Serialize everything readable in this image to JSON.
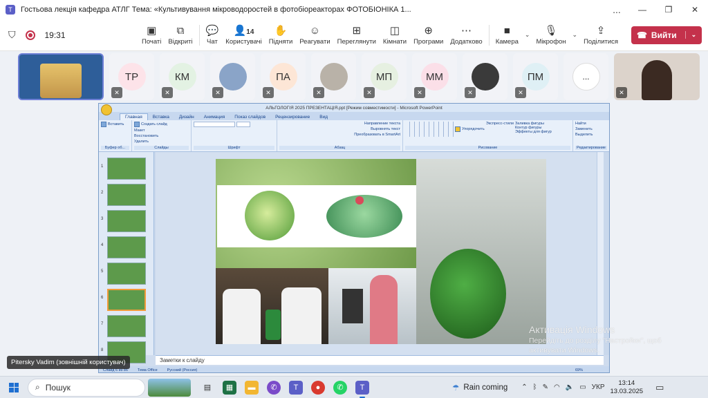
{
  "window": {
    "title": "Гостьова лекція кафедра АТЛГ Тема: «Культивування мікроводоростей в фотобіореакторах ФОТОБІОНІКА 1...",
    "more": "...",
    "minimize": "—",
    "restore": "❐",
    "close": "✕"
  },
  "meeting": {
    "timer": "19:31",
    "participants_count": "14",
    "buttons": {
      "chat": "Чат",
      "people": "Користувачі",
      "raise": "Підняти",
      "react": "Реагувати",
      "view": "Переглянути",
      "rooms": "Кімнати",
      "apps": "Програми",
      "more": "Додатково",
      "camera": "Камера",
      "mic": "Мікрофон",
      "share": "Поділитися",
      "leave": "Вийти"
    },
    "left_tabs": {
      "notes": "Початі",
      "shared": "Відкриті"
    }
  },
  "participants": [
    {
      "initials": "ТР",
      "color": "#fde3e9"
    },
    {
      "initials": "КМ",
      "color": "#e3f2e3"
    },
    {
      "initials": "",
      "color": "#8aa4c8"
    },
    {
      "initials": "ПА",
      "color": "#fde6d6"
    },
    {
      "initials": "",
      "color": "#b9b2a8"
    },
    {
      "initials": "МП",
      "color": "#e6f0e1"
    },
    {
      "initials": "ММ",
      "color": "#fbdfe8"
    },
    {
      "initials": "",
      "color": "#3a3a3a"
    },
    {
      "initials": "ПМ",
      "color": "#dff0f5"
    }
  ],
  "more_participants": "...",
  "powerpoint": {
    "title": "АЛЬГОЛОГІЯ 2025 ПРЕЗЕНТАЦІЯ.ppt [Режим совместимости] - Microsoft PowerPoint",
    "tabs": [
      "Главная",
      "Вставка",
      "Дизайн",
      "Анимация",
      "Показ слайдов",
      "Рецензирование",
      "Вид"
    ],
    "groups": {
      "clipboard": "Буфер об...",
      "slides": "Слайды",
      "font": "Шрифт",
      "paragraph": "Абзац",
      "drawing": "Рисование",
      "editing": "Редактирование"
    },
    "ribbon_items": {
      "paste": "Вставить",
      "create_slide": "Создать слайд",
      "layout": "Макет",
      "restore": "Восстановить",
      "delete": "Удалить",
      "text_direction": "Направление текста",
      "align_text": "Выровнять текст",
      "smartart": "Преобразовать в SmartArt",
      "arrange": "Упорядочить",
      "quick_styles": "Экспресс-стили",
      "fill": "Заливка фигуры",
      "outline": "Контур фигуры",
      "effects": "Эффекты для фигур",
      "find": "Найти",
      "replace": "Заменить",
      "select": "Выделить"
    },
    "slide_numbers": [
      "1",
      "2",
      "3",
      "4",
      "5",
      "6",
      "7",
      "8"
    ],
    "notes_placeholder": "Заметки к слайду",
    "status": {
      "slide": "Слайд 6 из 86",
      "theme": "Тема Office",
      "lang": "Русский (Россия)",
      "zoom": "69%"
    }
  },
  "speaker_name": "Pitersky Vadim (зовнішній користувач)",
  "watermark": {
    "line1": "Активація Windows",
    "line2": "Перейдіть до розділу \"Настройки\", щоб",
    "line3": "активувати Windows."
  },
  "taskbar": {
    "search_label": "Пошук",
    "weather": "Rain coming",
    "lang": "УКР",
    "time": "13:14",
    "date": "13.03.2025"
  }
}
